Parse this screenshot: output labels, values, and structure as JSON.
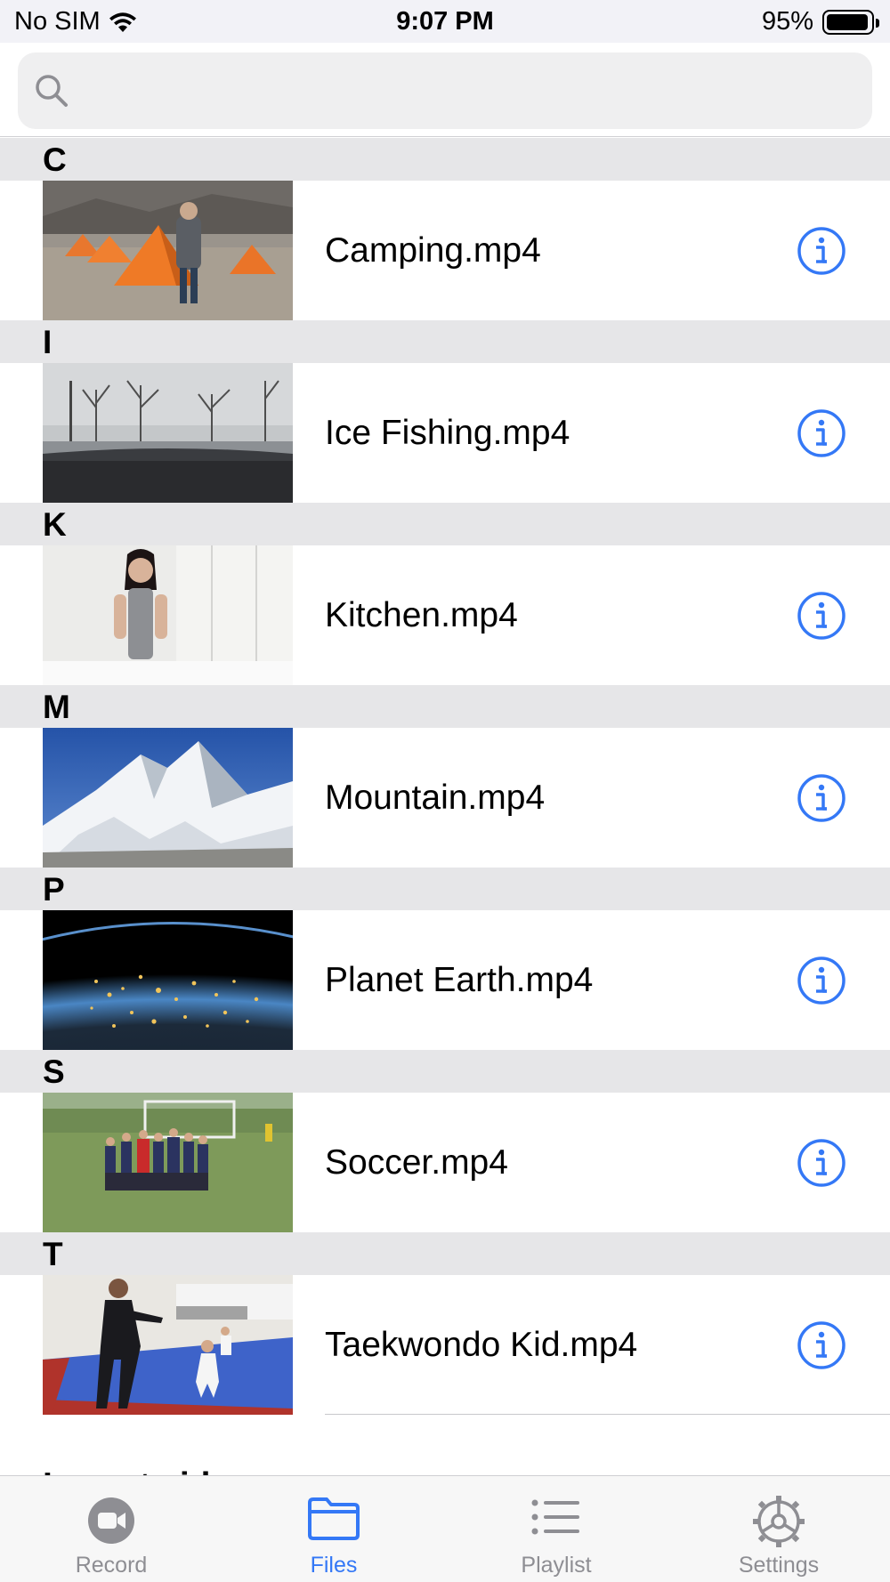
{
  "status_bar": {
    "carrier": "No SIM",
    "time": "9:07 PM",
    "battery": "95%",
    "battery_level": 0.95
  },
  "search": {
    "placeholder": "",
    "value": ""
  },
  "sections": [
    {
      "letter": "C",
      "items": [
        {
          "title": "Camping.mp4",
          "thumb": "camping"
        }
      ]
    },
    {
      "letter": "I",
      "items": [
        {
          "title": "Ice Fishing.mp4",
          "thumb": "ice-fishing"
        }
      ]
    },
    {
      "letter": "K",
      "items": [
        {
          "title": "Kitchen.mp4",
          "thumb": "kitchen"
        }
      ]
    },
    {
      "letter": "M",
      "items": [
        {
          "title": "Mountain.mp4",
          "thumb": "mountain"
        }
      ]
    },
    {
      "letter": "P",
      "items": [
        {
          "title": "Planet Earth.mp4",
          "thumb": "planet-earth"
        }
      ]
    },
    {
      "letter": "S",
      "items": [
        {
          "title": "Soccer.mp4",
          "thumb": "soccer"
        }
      ]
    },
    {
      "letter": "T",
      "items": [
        {
          "title": "Taekwondo Kid.mp4",
          "thumb": "taekwondo"
        }
      ]
    }
  ],
  "partial_text": "Import videos",
  "tabs": [
    {
      "label": "Record",
      "icon": "video-camera-icon",
      "active": false
    },
    {
      "label": "Files",
      "icon": "folder-icon",
      "active": true
    },
    {
      "label": "Playlist",
      "icon": "list-icon",
      "active": false
    },
    {
      "label": "Settings",
      "icon": "gear-icon",
      "active": false
    }
  ],
  "colors": {
    "accent": "#3478f6",
    "inactive": "#8e8e93",
    "section_header": "#e6e6e8"
  }
}
